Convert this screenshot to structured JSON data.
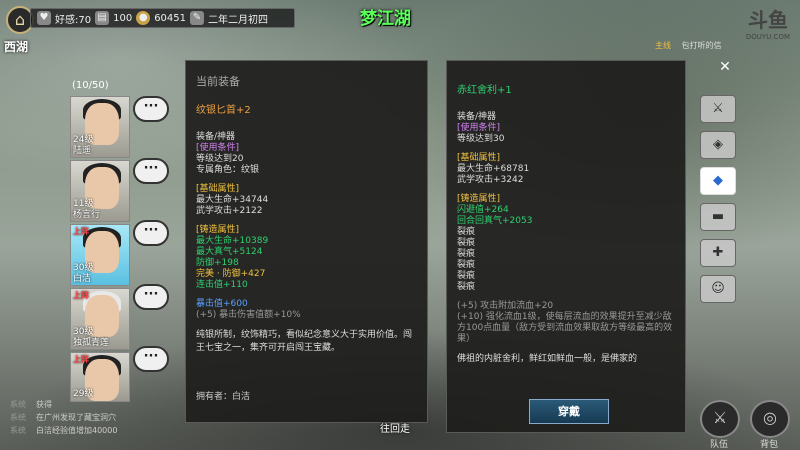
{
  "topbar": {
    "location": "西湖",
    "favor_label": "好感:70",
    "bag_count": "100",
    "money": "60451",
    "date": "二年二月初四",
    "area_title": "梦江湖"
  },
  "watermark": {
    "brand": "斗鱼",
    "url": "DOUYU.COM"
  },
  "quest": {
    "main": "主线",
    "text": "包打听的信"
  },
  "party": {
    "count": "(10/50)",
    "members": [
      {
        "level": "24级",
        "name": "陆遥",
        "tag": ""
      },
      {
        "level": "11级",
        "name": "杨言行",
        "tag": ""
      },
      {
        "level": "30级",
        "name": "白洁",
        "tag": "上阵"
      },
      {
        "level": "30级",
        "name": "独孤青莲",
        "tag": "上阵"
      },
      {
        "level": "29级",
        "name": "",
        "tag": "上阵"
      }
    ]
  },
  "log": [
    {
      "sys": "系统",
      "text": "获得"
    },
    {
      "sys": "系统",
      "text": "在广州发现了藏宝洞穴"
    },
    {
      "sys": "系统",
      "text": "白洁经验值增加40000"
    }
  ],
  "left_panel": {
    "header": "当前装备",
    "item_name": "纹银匕首+2",
    "type": "装备/神器",
    "req_title": "[使用条件]",
    "req_level": "等级达到20",
    "req_char": "专属角色：纹银",
    "base_title": "[基础属性]",
    "base_hp": "最大生命+34744",
    "base_atk": "武学攻击+2122",
    "forge_title": "[铸造属性]",
    "forge_1": "最大生命+10389",
    "forge_2": "最大真气+5124",
    "forge_3": "防御+198",
    "forge_4": "完美 · 防御+427",
    "forge_5": "连击值+110",
    "extra_1": "暴击值+600",
    "extra_2": "(+5) 暴击伤害值额+10%",
    "desc": "纯银所制，纹饰精巧，看似纪念意义大于实用价值。闯王七宝之一，集齐可开启闯王宝藏。",
    "owner": "拥有者：白洁"
  },
  "right_panel": {
    "item_name": "赤红舍利+1",
    "type": "装备/神器",
    "req_title": "[使用条件]",
    "req_level": "等级达到30",
    "base_title": "[基础属性]",
    "base_hp": "最大生命+68781",
    "base_atk": "武学攻击+3242",
    "forge_title": "[铸造属性]",
    "forge_1": "闪避值+264",
    "forge_2": "回合回真气+2053",
    "slot": "裂痕",
    "extra_1": "(+5) 攻击附加流血+20",
    "extra_2": "(+10) 强化流血1级，使每层流血的效果提升至减少敌方100点血量（敌方受到流血效果取敌方等级最高的效果）",
    "desc": "佛祖的内脏舍利，鲜红如鲜血一般，是佛家的",
    "equip_label": "穿戴"
  },
  "return_label": "往回走",
  "bottom": {
    "team": "队伍",
    "bag": "背包"
  }
}
